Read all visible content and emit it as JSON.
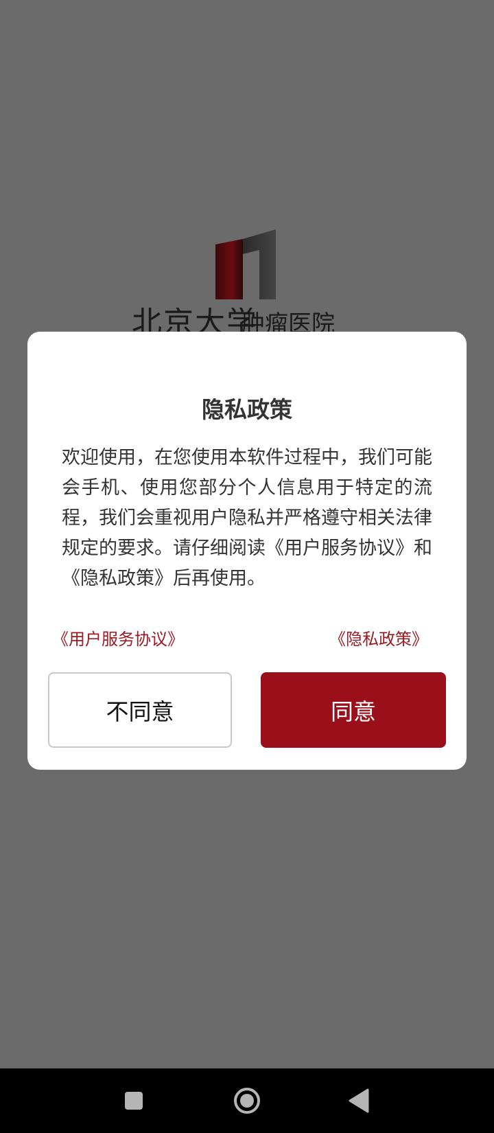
{
  "splash": {
    "logo_calligraphy": "北京大学",
    "logo_hospital": "肿瘤医院"
  },
  "dialog": {
    "title": "隐私政策",
    "body": "欢迎使用，在您使用本软件过程中，我们可能会手机、使用您部分个人信息用于特定的流程，我们会重视用户隐私并严格遵守相关法律规定的要求。请仔细阅读《用户服务协议》和《隐私政策》后再使用。",
    "link_user_agreement": "《用户服务协议》",
    "link_privacy_policy": "《隐私政策》",
    "disagree_label": "不同意",
    "agree_label": "同意"
  },
  "colors": {
    "accent": "#9b0f1a",
    "link": "#9b1b22",
    "overlay": "#6b6b6b",
    "nav_bar": "#000000"
  },
  "nav_bar": {
    "icons": [
      "recents-square-icon",
      "home-circle-icon",
      "back-triangle-icon"
    ]
  }
}
